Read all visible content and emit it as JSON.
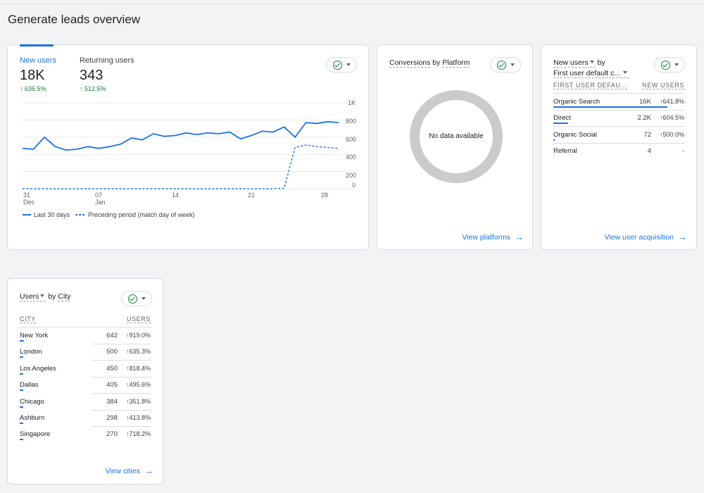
{
  "page_title": "Generate leads overview",
  "overview": {
    "tabs": [
      {
        "label": "New users",
        "value": "18K",
        "delta": "636.5%"
      },
      {
        "label": "Returning users",
        "value": "343",
        "delta": "512.5%"
      }
    ],
    "y_ticks": [
      "1K",
      "800",
      "600",
      "400",
      "200",
      "0"
    ],
    "x_ticks": [
      {
        "day": "31",
        "month": "Dec"
      },
      {
        "day": "07",
        "month": "Jan"
      },
      {
        "day": "14",
        "month": ""
      },
      {
        "day": "21",
        "month": ""
      },
      {
        "day": "28",
        "month": ""
      }
    ],
    "legend": {
      "current": "Last 30 days",
      "previous": "Preceding period (match day of week)"
    },
    "colors": {
      "accent": "#1a73e8",
      "positive": "#188038"
    }
  },
  "chart_data": {
    "type": "line",
    "title": "",
    "xlabel": "",
    "ylabel": "",
    "x": [
      "Dec 31",
      "Jan 1",
      "Jan 2",
      "Jan 3",
      "Jan 4",
      "Jan 5",
      "Jan 6",
      "Jan 7",
      "Jan 8",
      "Jan 9",
      "Jan 10",
      "Jan 11",
      "Jan 12",
      "Jan 13",
      "Jan 14",
      "Jan 15",
      "Jan 16",
      "Jan 17",
      "Jan 18",
      "Jan 19",
      "Jan 20",
      "Jan 21",
      "Jan 22",
      "Jan 23",
      "Jan 24",
      "Jan 25",
      "Jan 26",
      "Jan 27",
      "Jan 28",
      "Jan 29"
    ],
    "ylim": [
      0,
      1000
    ],
    "series": [
      {
        "name": "Last 30 days",
        "style": "solid",
        "values": [
          470,
          460,
          600,
          490,
          450,
          460,
          490,
          470,
          490,
          520,
          590,
          570,
          640,
          610,
          620,
          650,
          630,
          650,
          640,
          660,
          580,
          620,
          670,
          660,
          720,
          600,
          770,
          760,
          780,
          770
        ]
      },
      {
        "name": "Preceding period (match day of week)",
        "style": "dashed",
        "values": [
          0,
          0,
          0,
          0,
          0,
          0,
          0,
          0,
          0,
          0,
          0,
          0,
          0,
          0,
          0,
          0,
          0,
          0,
          0,
          0,
          0,
          0,
          0,
          0,
          5,
          480,
          510,
          490,
          480,
          470
        ]
      }
    ]
  },
  "platform": {
    "title_metric": "Conversions",
    "title_by": "by",
    "title_dim": "Platform",
    "empty_text": "No data available",
    "link": "View platforms"
  },
  "acquisition": {
    "title_metric": "New users",
    "title_by": "by",
    "title_dim": "First user default c...",
    "col_dim": "FIRST USER DEFAU...",
    "col_metric": "NEW USERS",
    "rows": [
      {
        "label": "Organic Search",
        "value": "16K",
        "delta": "641.8%",
        "share": 0.98
      },
      {
        "label": "Direct",
        "value": "2.2K",
        "delta": "604.5%",
        "share": 0.13
      },
      {
        "label": "Organic Social",
        "value": "72",
        "delta": "500.0%",
        "share": 0.01
      },
      {
        "label": "Referral",
        "value": "4",
        "delta": "-",
        "share": 0.0
      }
    ],
    "link": "View user acquisition"
  },
  "cities": {
    "title_metric": "Users",
    "title_by": "by",
    "title_dim": "City",
    "col_dim": "CITY",
    "col_metric": "USERS",
    "rows": [
      {
        "label": "New York",
        "value": "642",
        "delta": "919.0%",
        "share": 0.036
      },
      {
        "label": "London",
        "value": "500",
        "delta": "635.3%",
        "share": 0.028
      },
      {
        "label": "Los Angeles",
        "value": "450",
        "delta": "818.4%",
        "share": 0.025
      },
      {
        "label": "Dallas",
        "value": "405",
        "delta": "495.6%",
        "share": 0.022
      },
      {
        "label": "Chicago",
        "value": "384",
        "delta": "351.8%",
        "share": 0.021
      },
      {
        "label": "Ashburn",
        "value": "298",
        "delta": "413.8%",
        "share": 0.016
      },
      {
        "label": "Singapore",
        "value": "270",
        "delta": "718.2%",
        "share": 0.015
      }
    ],
    "link": "View cities"
  }
}
